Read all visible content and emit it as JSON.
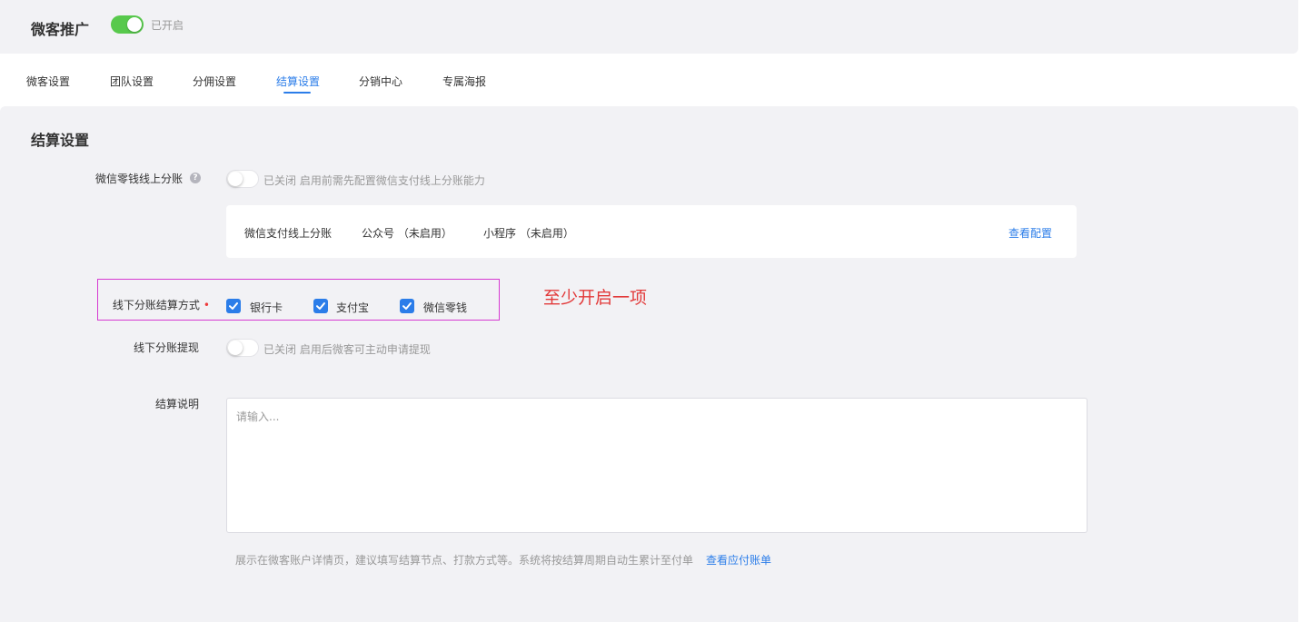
{
  "header": {
    "title": "微客推广",
    "toggle_on": true,
    "status": "已开启"
  },
  "tabs": [
    {
      "label": "微客设置",
      "active": false
    },
    {
      "label": "团队设置",
      "active": false
    },
    {
      "label": "分佣设置",
      "active": false
    },
    {
      "label": "结算设置",
      "active": true
    },
    {
      "label": "分销中心",
      "active": false
    },
    {
      "label": "专属海报",
      "active": false
    }
  ],
  "settlement": {
    "title": "结算设置",
    "wechat_split": {
      "label": "微信零钱线上分账",
      "help_icon": "question-circle-icon",
      "enabled": false,
      "status": "已关闭",
      "description": "启用前需先配置微信支付线上分账能力"
    },
    "pay_card": {
      "title": "微信支付线上分账",
      "official_account": "公众号 （未启用）",
      "mini_program": "小程序 （未启用）",
      "view_config": "查看配置"
    },
    "offline_method": {
      "label": "线下分账结算方式",
      "required_mark": "•",
      "options": [
        {
          "label": "银行卡",
          "checked": true
        },
        {
          "label": "支付宝",
          "checked": true
        },
        {
          "label": "微信零钱",
          "checked": true
        }
      ],
      "annotation": "至少开启一项"
    },
    "offline_withdraw": {
      "label": "线下分账提现",
      "enabled": false,
      "status": "已关闭",
      "description": "启用后微客可主动申请提现"
    },
    "description": {
      "label": "结算说明",
      "placeholder": "请输入...",
      "value": "",
      "hint": "展示在微客账户详情页，建议填写结算节点、打款方式等。系统将按结算周期自动生累计至付单",
      "hint_link": "查看应付账单"
    }
  },
  "colors": {
    "accent": "#2b7de9",
    "toggle_on": "#58c94c",
    "annotation": "#e23a3a",
    "highlight_border": "#d63ad1"
  }
}
